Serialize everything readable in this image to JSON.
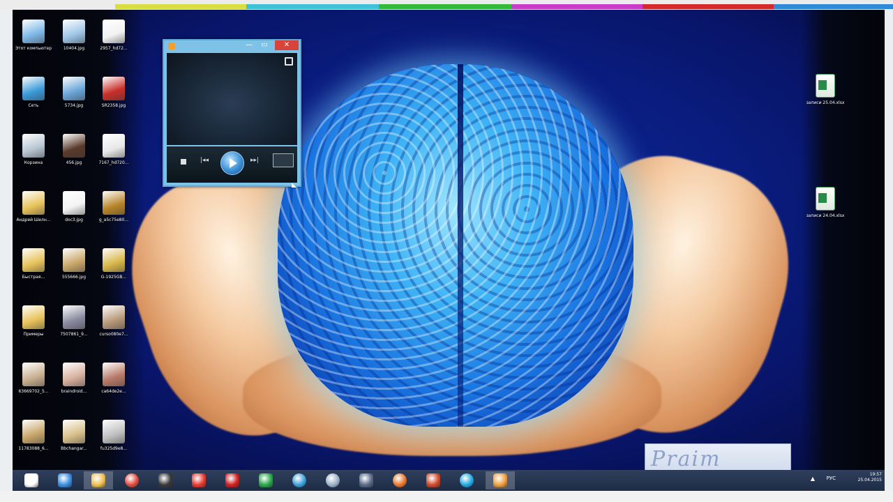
{
  "top_color_bar": [
    "#d8dd41",
    "#3fc1d8",
    "#35b93a",
    "#c93cc8",
    "#d32b2a",
    "#2f8bd7",
    "#f0f0f0"
  ],
  "desktop_icons_left": [
    {
      "label": "Этот компьютер",
      "icon": "computer-icon",
      "color": "#7db8e8"
    },
    {
      "label": "10404.jpg",
      "icon": "image-file-icon",
      "color": "#9ec6e8"
    },
    {
      "label": "2957_hd72...",
      "icon": "image-file-icon",
      "color": "#f2f2f2"
    },
    {
      "label": "Сеть",
      "icon": "network-icon",
      "color": "#3a9ad8"
    },
    {
      "label": "5734.jpg",
      "icon": "image-file-icon",
      "color": "#6aa6d8"
    },
    {
      "label": "SR2358.jpg",
      "icon": "image-file-icon",
      "color": "#c92f2a"
    },
    {
      "label": "Корзина",
      "icon": "recycle-bin-icon",
      "color": "#b8c6d4"
    },
    {
      "label": "456.jpg",
      "icon": "image-file-icon",
      "color": "#5a3a2a"
    },
    {
      "label": "7167_hd720...",
      "icon": "image-file-icon",
      "color": "#e8e8e8"
    },
    {
      "label": "Андрей Шелн...",
      "icon": "folder-icon",
      "color": "#e8c35a"
    },
    {
      "label": "doc3.jpg",
      "icon": "document-icon",
      "color": "#f4f4f4"
    },
    {
      "label": "g_a5c75e80...",
      "icon": "image-file-icon",
      "color": "#b8862a"
    },
    {
      "label": "Быстрая...",
      "icon": "folder-icon",
      "color": "#e8c35a"
    },
    {
      "label": "555666.jpg",
      "icon": "image-file-icon",
      "color": "#c9a86a"
    },
    {
      "label": "G-1925GB...",
      "icon": "image-file-icon",
      "color": "#d8b84a"
    },
    {
      "label": "Примеры",
      "icon": "folder-icon",
      "color": "#e8c35a"
    },
    {
      "label": "7507861_9...",
      "icon": "image-file-icon",
      "color": "#8a8aa0"
    },
    {
      "label": "curso080e7...",
      "icon": "image-file-icon",
      "color": "#b99a7a"
    },
    {
      "label": "63669702_5...",
      "icon": "image-file-icon",
      "color": "#c9b090"
    },
    {
      "label": "braindroid...",
      "icon": "image-file-icon",
      "color": "#d8b0a0"
    },
    {
      "label": "ca64de2e...",
      "icon": "image-file-icon",
      "color": "#b87a6a"
    },
    {
      "label": "11783088_6...",
      "icon": "image-file-icon",
      "color": "#c9a66a"
    },
    {
      "label": "Bbchangar...",
      "icon": "image-file-icon",
      "color": "#d8c08a"
    },
    {
      "label": "fu325d9e8...",
      "icon": "image-file-icon",
      "color": "#c0c0c0"
    }
  ],
  "desktop_icons_right": [
    {
      "label": "записи 25.04.xlsx",
      "icon": "excel-file-icon"
    },
    {
      "label": "записи 24.04.xlsx",
      "icon": "excel-file-icon"
    }
  ],
  "media_player": {
    "title": "",
    "minimize_glyph": "—",
    "maximize_glyph": "▭",
    "close_glyph": "✕",
    "prev_glyph": "|◂◂",
    "next_glyph": "▸▸|"
  },
  "watermark": {
    "text": "Praim"
  },
  "taskbar": {
    "items": [
      {
        "name": "start-button-icon",
        "color": "#ffffff"
      },
      {
        "name": "internet-explorer-icon",
        "color": "#3a8fe0"
      },
      {
        "name": "file-explorer-icon",
        "color": "#f0c050"
      },
      {
        "name": "chrome-icon",
        "color": "#e04a3a"
      },
      {
        "name": "remote-desktop-icon",
        "color": "#3a3a3a"
      },
      {
        "name": "yandex-browser-icon",
        "color": "#e83a30"
      },
      {
        "name": "record-app-icon",
        "color": "#d02020"
      },
      {
        "name": "office-app-icon",
        "color": "#2aa84a"
      },
      {
        "name": "picture-manager-icon",
        "color": "#3aa0d8"
      },
      {
        "name": "network-settings-icon",
        "color": "#9ab0c8"
      },
      {
        "name": "satellite-app-icon",
        "color": "#5a6a8a"
      },
      {
        "name": "firefox-icon",
        "color": "#e8762a"
      },
      {
        "name": "powerpoint-icon",
        "color": "#d04a2a"
      },
      {
        "name": "skype-icon",
        "color": "#1fa8e0"
      },
      {
        "name": "media-player-taskbar-icon",
        "color": "#f0a040"
      }
    ],
    "tray_lang": "РУС",
    "tray_arrow": "▲",
    "clock_time": "19:57",
    "clock_date": "25.04.2015"
  }
}
